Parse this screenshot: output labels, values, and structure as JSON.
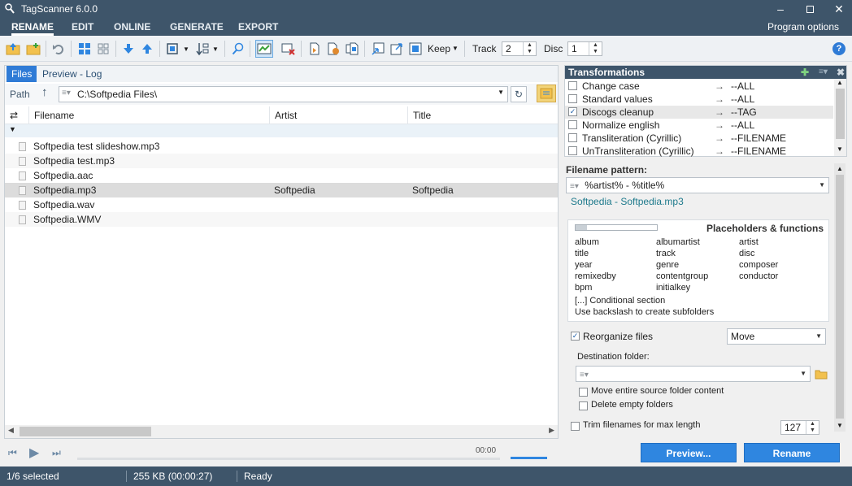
{
  "window": {
    "title": "TagScanner 6.0.0"
  },
  "menu": {
    "tabs": [
      "RENAME",
      "EDIT",
      "ONLINE",
      "GENERATE",
      "EXPORT"
    ],
    "program_options": "Program options"
  },
  "toolbar": {
    "keep_label": "Keep",
    "track_label": "Track",
    "track_value": "2",
    "disc_label": "Disc",
    "disc_value": "1"
  },
  "left": {
    "tabs": [
      "Files",
      "Preview - Log"
    ],
    "path_label": "Path",
    "path_value": "C:\\Softpedia Files\\",
    "columns": [
      "Filename",
      "Artist",
      "Title"
    ],
    "files": [
      {
        "name": "Softpedia test slideshow.mp3",
        "artist": "",
        "title": ""
      },
      {
        "name": "Softpedia test.mp3",
        "artist": "",
        "title": ""
      },
      {
        "name": "Softpedia.aac",
        "artist": "",
        "title": ""
      },
      {
        "name": "Softpedia.mp3",
        "artist": "Softpedia",
        "title": "Softpedia"
      },
      {
        "name": "Softpedia.wav",
        "artist": "",
        "title": ""
      },
      {
        "name": "Softpedia.WMV",
        "artist": "",
        "title": ""
      }
    ],
    "selected_index": 3,
    "player_time": "00:00"
  },
  "transformations": {
    "title": "Transformations",
    "items": [
      {
        "name": "Change case",
        "arrow": "→",
        "target": "--ALL",
        "checked": false
      },
      {
        "name": "Standard values",
        "arrow": "→",
        "target": "--ALL",
        "checked": false
      },
      {
        "name": "Discogs cleanup",
        "arrow": "→",
        "target": "--TAG",
        "checked": true
      },
      {
        "name": "Normalize english",
        "arrow": "→",
        "target": "--ALL",
        "checked": false
      },
      {
        "name": "Transliteration (Cyrillic)",
        "arrow": "→",
        "target": "--FILENAME",
        "checked": false
      },
      {
        "name": "UnTransliteration (Cyrillic)",
        "arrow": "→",
        "target": "--FILENAME",
        "checked": false
      }
    ]
  },
  "pattern": {
    "label": "Filename pattern:",
    "value": "%artist% - %title%",
    "preview": "Softpedia - Softpedia.mp3"
  },
  "placeholders": {
    "title": "Placeholders & functions",
    "col1": [
      "album",
      "title",
      "year",
      "remixedby",
      "bpm"
    ],
    "col2": [
      "albumartist",
      "track",
      "genre",
      "contentgroup",
      "initialkey"
    ],
    "col3": [
      "artist",
      "disc",
      "composer",
      "conductor"
    ],
    "note1": "[...] Conditional section",
    "note2": "Use backslash to create subfolders"
  },
  "reorganize": {
    "label": "Reorganize files",
    "checked": true,
    "mode": "Move",
    "dest_label": "Destination folder:",
    "dest_value": "",
    "move_source": "Move entire source folder content",
    "delete_empty": "Delete empty folders"
  },
  "trim": {
    "label": "Trim filenames for max length",
    "value": "127"
  },
  "buttons": {
    "preview": "Preview...",
    "rename": "Rename"
  },
  "status": {
    "selected": "1/6 selected",
    "size": "255 KB (00:00:27)",
    "state": "Ready"
  },
  "colors": {
    "chrome": "#3e556a",
    "accent": "#2f86e0",
    "selected_row": "#dcdcdc"
  }
}
